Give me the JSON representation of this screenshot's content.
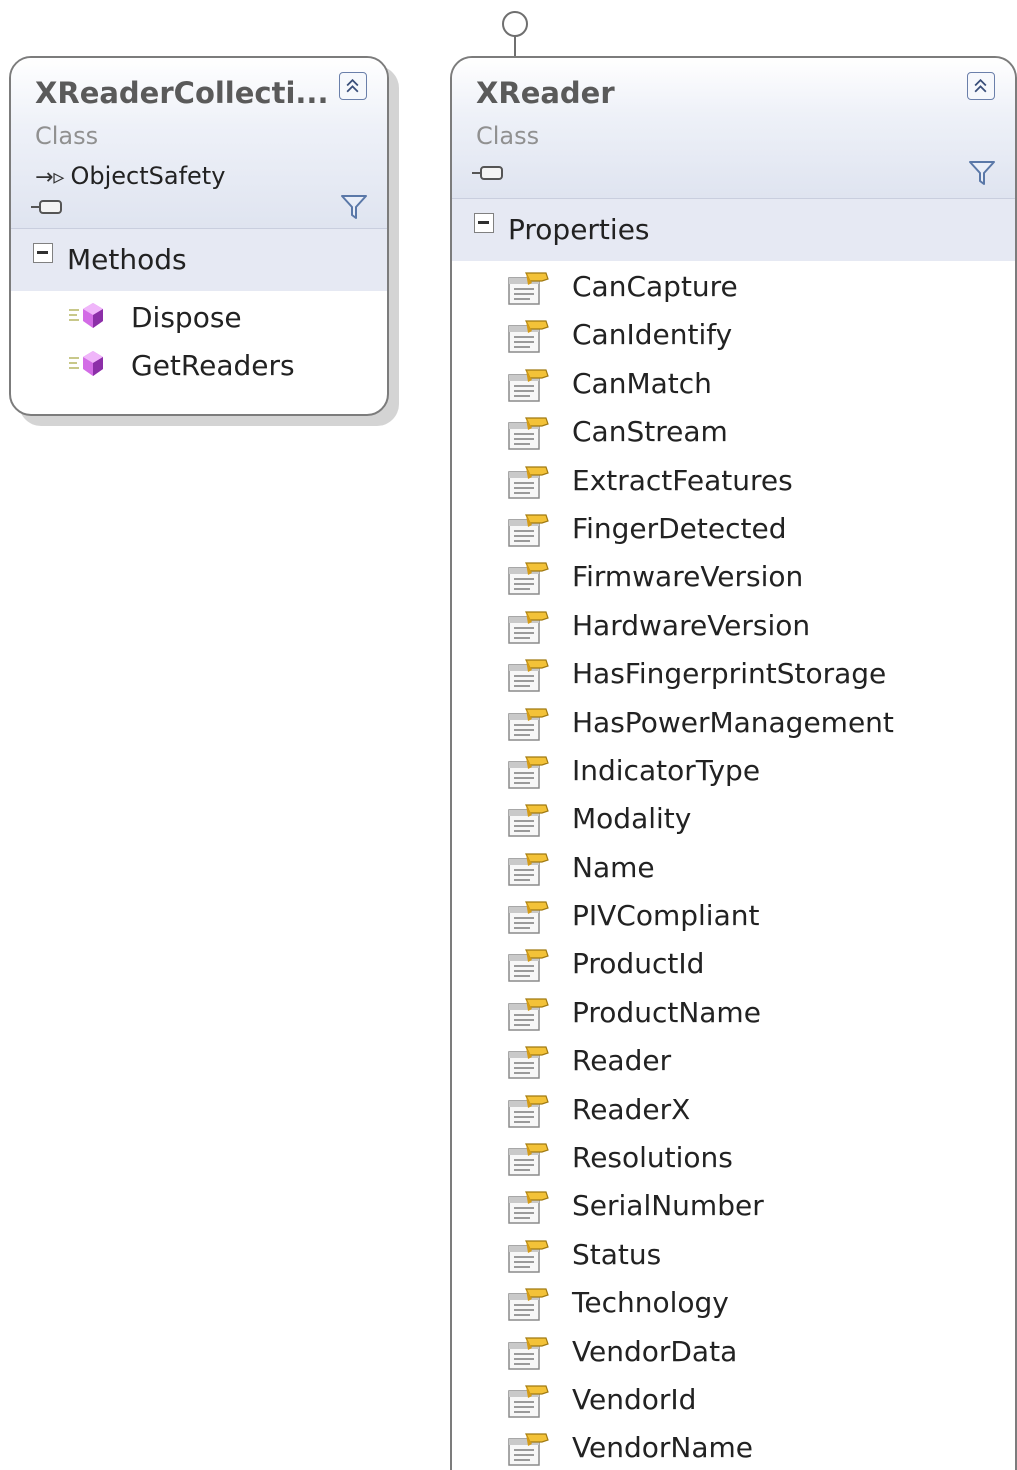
{
  "left_class": {
    "name": "XReaderCollecti...",
    "stereotype": "Class",
    "base_class": "ObjectSafety",
    "compartment": "Methods",
    "members": [
      "Dispose",
      "GetReaders"
    ]
  },
  "right_class": {
    "name": "XReader",
    "stereotype": "Class",
    "compartment": "Properties",
    "members": [
      "CanCapture",
      "CanIdentify",
      "CanMatch",
      "CanStream",
      "ExtractFeatures",
      "FingerDetected",
      "FirmwareVersion",
      "HardwareVersion",
      "HasFingerprintStorage",
      "HasPowerManagement",
      "IndicatorType",
      "Modality",
      "Name",
      "PIVCompliant",
      "ProductId",
      "ProductName",
      "Reader",
      "ReaderX",
      "Resolutions",
      "SerialNumber",
      "Status",
      "Technology",
      "VendorData",
      "VendorId",
      "VendorName"
    ]
  },
  "icons": {
    "collapse": "double-chevron-up-icon",
    "filter": "filter-funnel-icon",
    "interface": "interface-lollipop-icon",
    "method": "method-icon",
    "property": "property-icon",
    "inheritance": "inheritance-arrow-icon",
    "compartment_toggle": "minus-collapse-icon"
  },
  "colors": {
    "border": "#7c7c7c",
    "header_gradient_end": "#dfe4f0",
    "compartment_bg": "#e6e9f3",
    "method_icon": "#b04cc8",
    "property_icon": "#e8b62a",
    "accent": "#6a7faa"
  }
}
